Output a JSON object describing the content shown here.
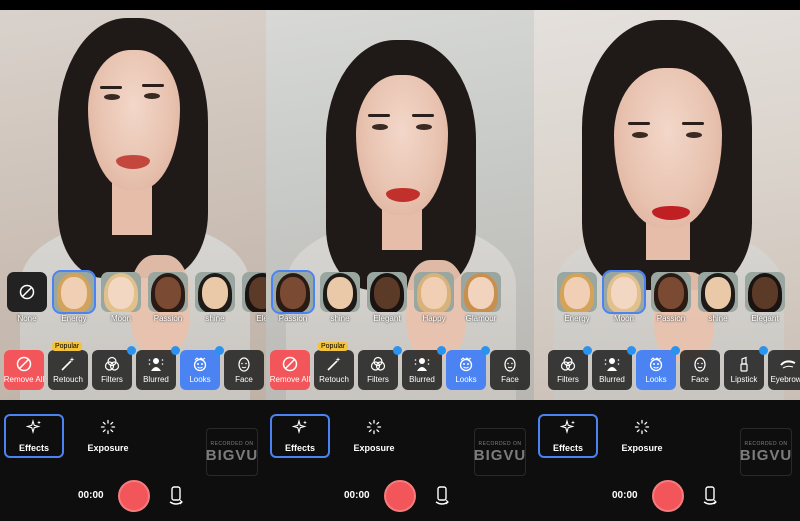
{
  "panels": [
    {
      "looks": [
        {
          "label": "None",
          "type": "none"
        },
        {
          "label": "Energy",
          "skin": "#f1cfb5",
          "hair": "#d4a35a",
          "active": true
        },
        {
          "label": "Moon",
          "skin": "#f2d7c2",
          "hair": "#e1c08c"
        },
        {
          "label": "Passion",
          "skin": "#7a4a33",
          "hair": "#2a1a14"
        },
        {
          "label": "shine",
          "skin": "#e9c9a7",
          "hair": "#1e1a18"
        },
        {
          "label": "Ele",
          "skin": "#5c3a28",
          "hair": "#1a1311"
        }
      ],
      "tools": [
        {
          "label": "Remove All",
          "icon": "prohibit-icon",
          "style": "red"
        },
        {
          "label": "Retouch",
          "icon": "magic-wand-icon",
          "badge": "Popular"
        },
        {
          "label": "Filters",
          "icon": "filters-icon",
          "dot": true
        },
        {
          "label": "Blurred",
          "icon": "blur-person-icon",
          "dot": true
        },
        {
          "label": "Looks",
          "icon": "looks-icon",
          "style": "blue",
          "dot": true
        },
        {
          "label": "Face",
          "icon": "face-icon"
        }
      ],
      "modes": [
        {
          "label": "Effects",
          "icon": "sparkles-icon",
          "active": true
        },
        {
          "label": "Exposure",
          "icon": "exposure-icon"
        }
      ],
      "timer": "00:00",
      "watermark": {
        "line1": "RECORDED ON",
        "line2": "BIGVU"
      }
    },
    {
      "looks": [
        {
          "label": "Passion",
          "skin": "#7a4a33",
          "hair": "#2a1a14",
          "active": true
        },
        {
          "label": "shine",
          "skin": "#e9c9a7",
          "hair": "#1e1a18"
        },
        {
          "label": "Elegant",
          "skin": "#5c3a28",
          "hair": "#1a1311"
        },
        {
          "label": "Happy",
          "skin": "#f1cfb5",
          "hair": "#d9b27a"
        },
        {
          "label": "Glamour",
          "skin": "#f2d3bd",
          "hair": "#c98f4f"
        }
      ],
      "tools": [
        {
          "label": "Remove All",
          "icon": "prohibit-icon",
          "style": "red"
        },
        {
          "label": "Retouch",
          "icon": "magic-wand-icon",
          "badge": "Popular"
        },
        {
          "label": "Filters",
          "icon": "filters-icon",
          "dot": true
        },
        {
          "label": "Blurred",
          "icon": "blur-person-icon",
          "dot": true
        },
        {
          "label": "Looks",
          "icon": "looks-icon",
          "style": "blue",
          "dot": true
        },
        {
          "label": "Face",
          "icon": "face-icon"
        }
      ],
      "modes": [
        {
          "label": "Effects",
          "icon": "sparkles-icon",
          "active": true
        },
        {
          "label": "Exposure",
          "icon": "exposure-icon"
        }
      ],
      "timer": "00:00",
      "watermark": {
        "line1": "RECORDED ON",
        "line2": "BIGVU"
      }
    },
    {
      "looks": [
        {
          "label": "Energy",
          "skin": "#f1cfb5",
          "hair": "#d4a35a"
        },
        {
          "label": "Moon",
          "skin": "#f2d7c2",
          "hair": "#e1c08c",
          "active": true
        },
        {
          "label": "Passion",
          "skin": "#7a4a33",
          "hair": "#2a1a14"
        },
        {
          "label": "shine",
          "skin": "#e9c9a7",
          "hair": "#1e1a18"
        },
        {
          "label": "Elegant",
          "skin": "#5c3a28",
          "hair": "#1a1311"
        }
      ],
      "tools": [
        {
          "label": "Filters",
          "icon": "filters-icon",
          "dot": true
        },
        {
          "label": "Blurred",
          "icon": "blur-person-icon",
          "dot": true
        },
        {
          "label": "Looks",
          "icon": "looks-icon",
          "style": "blue",
          "dot": true
        },
        {
          "label": "Face",
          "icon": "face-icon"
        },
        {
          "label": "Lipstick",
          "icon": "lipstick-icon",
          "dot": true
        },
        {
          "label": "Eyebrows",
          "icon": "eyebrows-icon",
          "dot": true
        }
      ],
      "modes": [
        {
          "label": "Effects",
          "icon": "sparkles-icon",
          "active": true
        },
        {
          "label": "Exposure",
          "icon": "exposure-icon"
        }
      ],
      "timer": "00:00",
      "watermark": {
        "line1": "RECORDED ON",
        "line2": "BIGVU"
      }
    }
  ],
  "colors": {
    "accent": "#4b83f2",
    "record": "#f2565a",
    "dot": "#2a93f0",
    "badge": "#f4c33d"
  }
}
